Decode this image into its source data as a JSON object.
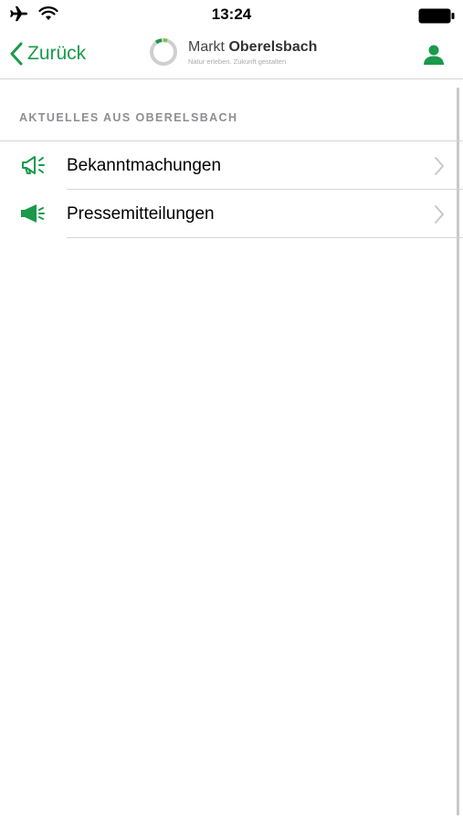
{
  "status_bar": {
    "time": "13:24"
  },
  "nav": {
    "back_label": "Zurück",
    "logo_name_light": "Markt ",
    "logo_name_bold": "Oberelsbach",
    "logo_tagline": "Natur erleben. Zukunft gestalten",
    "profile_icon": "person-icon"
  },
  "section": {
    "title": "AKTUELLES AUS OBERELSBACH"
  },
  "items": [
    {
      "label": "Bekanntmachungen",
      "icon": "megaphone-outline-icon"
    },
    {
      "label": "Pressemitteilungen",
      "icon": "megaphone-filled-icon"
    }
  ],
  "colors": {
    "accent": "#1a9a4a",
    "separator": "#d5d5d5",
    "section_text": "#8e8e93",
    "chevron": "#c7c7cc"
  }
}
